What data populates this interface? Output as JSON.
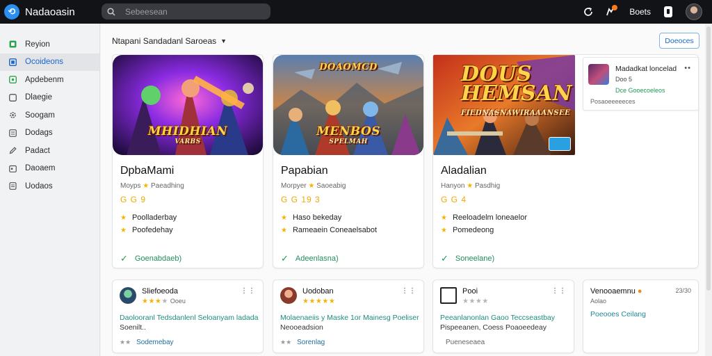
{
  "app": {
    "title": "Nadaoasin"
  },
  "search": {
    "placeholder": "Sebeesean"
  },
  "topbar": {
    "link": "Boets"
  },
  "colors": {
    "accent": "#1b66c9",
    "topbar_bg": "#121317",
    "star": "#f5b301",
    "success": "#1e9a52",
    "notif": "#ff7a1a"
  },
  "sidebar": {
    "items": [
      {
        "label": "Reyion",
        "icon": "square-check-icon",
        "active": false
      },
      {
        "label": "Ocoideons",
        "icon": "grid-icon",
        "active": true
      },
      {
        "label": "Apdebenm",
        "icon": "square-dot-icon",
        "active": false
      },
      {
        "label": "Dlaegie",
        "icon": "square-outline-icon",
        "active": false
      },
      {
        "label": "Soogam",
        "icon": "gear-icon",
        "active": false
      },
      {
        "label": "Dodags",
        "icon": "list-icon",
        "active": false
      },
      {
        "label": "Padact",
        "icon": "pen-icon",
        "active": false
      },
      {
        "label": "Daoaem",
        "icon": "calendar-icon",
        "active": false
      },
      {
        "label": "Uodaos",
        "icon": "document-icon",
        "active": false
      }
    ]
  },
  "main": {
    "sort_label": "Ntapani Sandadanl Saroeas",
    "action_button": "Doeoces",
    "games": [
      {
        "art_logo": "MHIDHIAN",
        "art_logo_sub": "VARBS",
        "title": "DpbaMami",
        "meta_prefix": "Moyps",
        "meta_suffix": "Paeadhing",
        "rating": "G G 9",
        "features": [
          "Poolladerbay",
          "Poofedehay"
        ],
        "cta": "Goenabdaeb)"
      },
      {
        "art_logo": "MENBOS",
        "art_logo_sub": "SPELMAH",
        "art_logo_top": "DOAOMCD",
        "title": "Papabian",
        "meta_prefix": "Morpyer",
        "meta_suffix": "Saoeabig",
        "rating": "G G 19 3",
        "features": [
          "Haso bekeday",
          "Rameaein Coneaelsabot"
        ],
        "cta": "Adeenlasna)"
      },
      {
        "art_logo": "DOUS HEMSAN",
        "art_logo_sub": "FIEDNASNAWIRAAANSEE",
        "title": "Aladalian",
        "meta_prefix": "Hanyon",
        "meta_suffix": "Pasdhig",
        "rating": "G G 4",
        "features": [
          "Reeloadelm loneaelor",
          "Pomedeong"
        ],
        "cta": "Soneelane)"
      }
    ],
    "side_card": {
      "title": "Madadkat loncelad",
      "sub": "Doo 5",
      "link": "Dce Gooecoeleos",
      "foot": "Posaoeeeeeces"
    },
    "reviews": [
      {
        "name": "Sliefoeoda",
        "stars": "★★★",
        "grey": "★",
        "sub": "Ooeu",
        "text": "Daolooranl Tedsdanlenl Seloanyam ladada",
        "text2": "Soenilt..",
        "foot_stars": "★★",
        "foot": "Sodemebay"
      },
      {
        "name": "Uodoban",
        "stars": "★★★★★",
        "grey": "",
        "sub": "",
        "text": "Molaenaeiis y Maske 1or Mainesg Poeliser",
        "text2": "Neooeadsion",
        "foot_stars": "★★",
        "foot": "Sorenlag"
      },
      {
        "name": "Pooi",
        "stars": "",
        "grey": "★★★★",
        "sub": "",
        "text": "Peeanlanonlan Gaoo Teccseastbay",
        "text2": "Pispeeanen, Coess Poaoeedeay",
        "foot_stars": "",
        "foot": "Pueneseaea"
      },
      {
        "name": "Venooaemnu",
        "stars": "",
        "grey": "",
        "sub": "Aolao",
        "text": "",
        "text2": "",
        "foot_stars": "",
        "foot": "",
        "link": "Poeooes Ceilang",
        "meta": "23/30"
      }
    ]
  }
}
